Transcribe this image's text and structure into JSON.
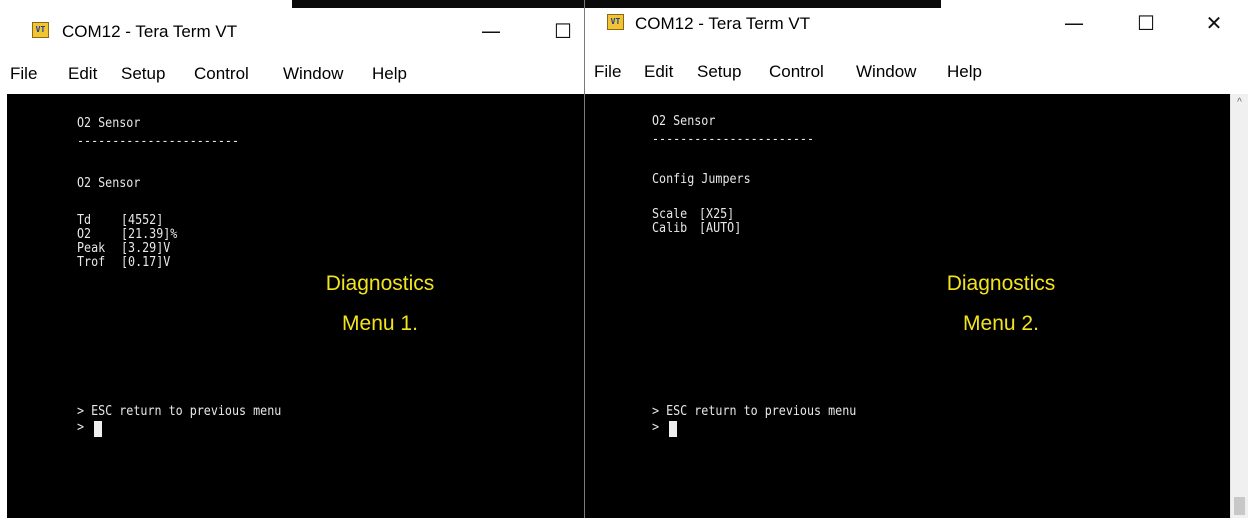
{
  "window1": {
    "title": "COM12 - Tera Term VT",
    "icon": "VT",
    "menu": [
      "File",
      "Edit",
      "Setup",
      "Control",
      "Window",
      "Help"
    ],
    "controls": {
      "minimize": "—",
      "maximize": "☐"
    },
    "terminal": {
      "heading": "O2 Sensor",
      "rule": "-----------------------",
      "section": "O2 Sensor",
      "rows": [
        {
          "label": "Td",
          "value": "[4552]"
        },
        {
          "label": "O2",
          "value": "[21.39]%"
        },
        {
          "label": "Peak",
          "value": "[3.29]V"
        },
        {
          "label": "Trof",
          "value": "[0.17]V"
        }
      ],
      "footer": "> ESC return to previous menu",
      "prompt": ">"
    },
    "annotation": {
      "line1": "Diagnostics",
      "line2": "Menu 1."
    }
  },
  "window2": {
    "title": "COM12 - Tera Term VT",
    "icon": "VT",
    "menu": [
      "File",
      "Edit",
      "Setup",
      "Control",
      "Window",
      "Help"
    ],
    "controls": {
      "minimize": "—",
      "maximize": "☐",
      "close": "✕"
    },
    "terminal": {
      "heading": "O2 Sensor",
      "rule": "-----------------------",
      "section": "Config Jumpers",
      "rows": [
        {
          "label": "Scale",
          "value": "[X25]"
        },
        {
          "label": "Calib",
          "value": "[AUTO]"
        }
      ],
      "footer": "> ESC return to previous menu",
      "prompt": ">"
    },
    "annotation": {
      "line1": "Diagnostics",
      "line2": "Menu 2."
    },
    "scrollbar": {
      "up_arrow": "^"
    }
  }
}
